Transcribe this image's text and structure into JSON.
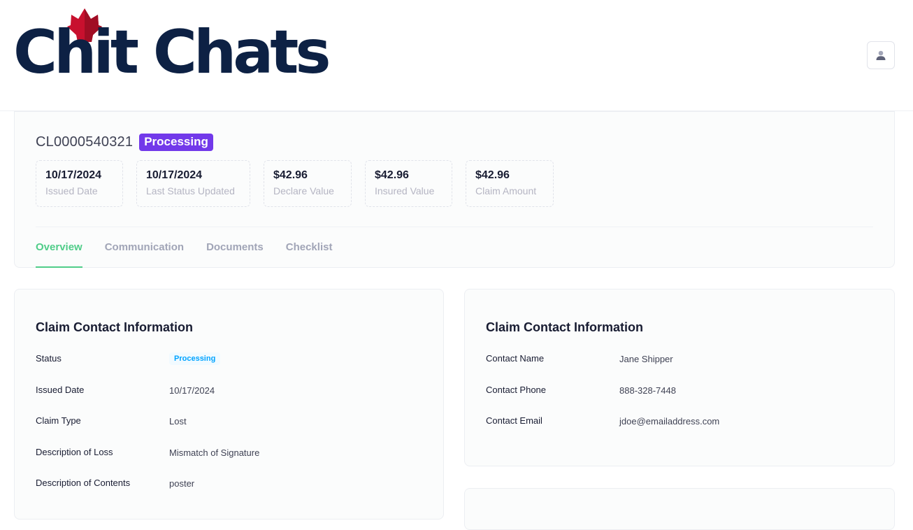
{
  "brand": {
    "name": "Chit Chats",
    "accent": "#c8102e",
    "navy": "#0d2144"
  },
  "header": {
    "user_icon": "user-icon"
  },
  "claim": {
    "id": "CL0000540321",
    "status": "Processing",
    "stats": [
      {
        "value": "10/17/2024",
        "label": "Issued Date"
      },
      {
        "value": "10/17/2024",
        "label": "Last Status Updated"
      },
      {
        "value": "$42.96",
        "label": "Declare Value"
      },
      {
        "value": "$42.96",
        "label": "Insured Value"
      },
      {
        "value": "$42.96",
        "label": "Claim Amount"
      }
    ]
  },
  "tabs": [
    {
      "label": "Overview",
      "active": true
    },
    {
      "label": "Communication",
      "active": false
    },
    {
      "label": "Documents",
      "active": false
    },
    {
      "label": "Checklist",
      "active": false
    }
  ],
  "left_card": {
    "title": "Claim Contact Information",
    "rows": [
      {
        "key": "Status",
        "value": "Processing"
      },
      {
        "key": "Issued Date",
        "value": "10/17/2024"
      },
      {
        "key": "Claim Type",
        "value": "Lost"
      },
      {
        "key": "Description of Loss",
        "value": "Mismatch of Signature"
      },
      {
        "key": "Description of Contents",
        "value": "poster"
      }
    ]
  },
  "right_card": {
    "title": "Claim Contact Information",
    "rows": [
      {
        "key": "Contact Name",
        "value": "Jane Shipper"
      },
      {
        "key": "Contact Phone",
        "value": "888-328-7448"
      },
      {
        "key": "Contact Email",
        "value": "jdoe@emailaddress.com"
      }
    ]
  },
  "colors": {
    "processing_badge": "#7239ea",
    "active_tab": "#50cd89",
    "status_light": "#00a3ff"
  }
}
